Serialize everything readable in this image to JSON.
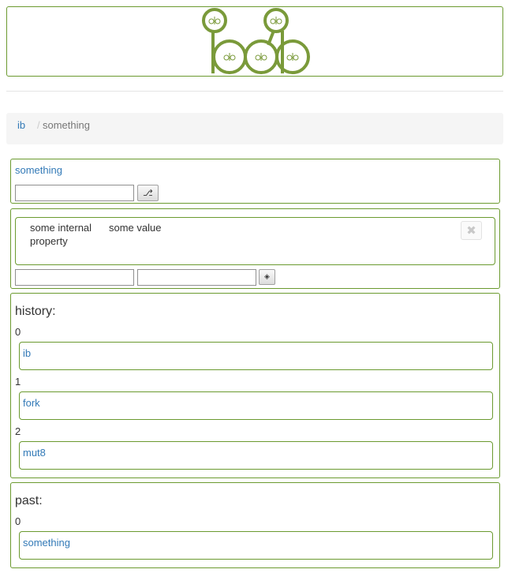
{
  "breadcrumb": {
    "root": "ib",
    "separator": "/",
    "active": "something"
  },
  "ib": {
    "name": "something",
    "fork_input_value": "",
    "fork_button_icon": "⎇"
  },
  "rel8n": {
    "key": "some internal property",
    "value": "some value",
    "remove_icon": "✖",
    "new_key_value": "",
    "new_value_value": "",
    "add_button_icon": "◈"
  },
  "history": {
    "title": "history:",
    "items": [
      {
        "index": "0",
        "label": "ib"
      },
      {
        "index": "1",
        "label": "fork"
      },
      {
        "index": "2",
        "label": "mut8"
      }
    ]
  },
  "past": {
    "title": "past:",
    "items": [
      {
        "index": "0",
        "label": "something"
      }
    ]
  },
  "colors": {
    "panel_border": "#6b9a2f",
    "link": "#337ab7",
    "breadcrumb_bg": "#f5f5f5",
    "logo": "#7a9a3a"
  },
  "icons": {
    "logo": "ibgib-logo",
    "fork": "fork-icon",
    "remove": "close-icon",
    "add": "add-icon"
  }
}
